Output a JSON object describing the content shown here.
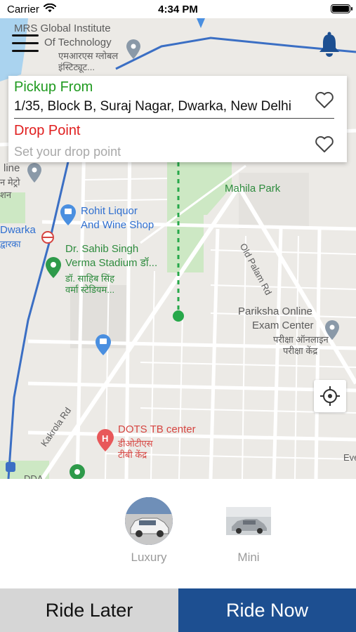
{
  "status_bar": {
    "carrier": "Carrier",
    "time": "4:34 PM"
  },
  "address_card": {
    "pickup_label": "Pickup From",
    "pickup_address": "1/35, Block B, Suraj Nagar, Dwarka, New Delhi",
    "drop_label": "Drop Point",
    "drop_placeholder": "Set your drop point",
    "drop_value": ""
  },
  "map": {
    "labels": {
      "mrs_institute_en_1": "MRS Global Institute",
      "mrs_institute_en_2": "Of Technology",
      "mrs_institute_hi_1": "एमआरएस ग्लोबल",
      "mrs_institute_hi_2": "इंस्टिट्यूट...",
      "line": "line",
      "line_hi": "न मेट्रो",
      "line_hi_2": "शन",
      "dwarka": "Dwarka",
      "dwarka_hi": "द्वारका",
      "rohit_liquor_1": "Rohit Liquor",
      "rohit_liquor_2": "And Wine Shop",
      "stadium_1": "Dr. Sahib Singh",
      "stadium_2": "Verma Stadium डॉ...",
      "stadium_hi_1": "डॉ. साहिब सिंह",
      "stadium_hi_2": "वर्मा स्टेडियम...",
      "mahila_park": "Mahila Park",
      "old_palam_rd": "Old Palam Rd",
      "pariksha_1": "Pariksha Online",
      "pariksha_2": "Exam Center",
      "pariksha_hi_1": "परीक्षा ऑनलाइन",
      "pariksha_hi_2": "परीक्षा केंद्र",
      "kakrola_rd": "Kakrola Rd",
      "dots_tb": "DOTS TB center",
      "dots_tb_hi_1": "डीओटीएस",
      "dots_tb_hi_2": "टीबी केंद्र",
      "eve": "Eve",
      "dda": "DDA"
    },
    "colors": {
      "park": "#cde8c4",
      "road": "#ffffff",
      "metro": "#3b6fc4",
      "route": "#27a84a"
    }
  },
  "vehicles": [
    {
      "name": "Luxury",
      "selected": true
    },
    {
      "name": "Mini",
      "selected": false
    }
  ],
  "actions": {
    "ride_later": "Ride Later",
    "ride_now": "Ride Now"
  },
  "theme": {
    "primary": "#1d4f91",
    "pickup_color": "#1f9a1f",
    "drop_color": "#e01f1f"
  }
}
